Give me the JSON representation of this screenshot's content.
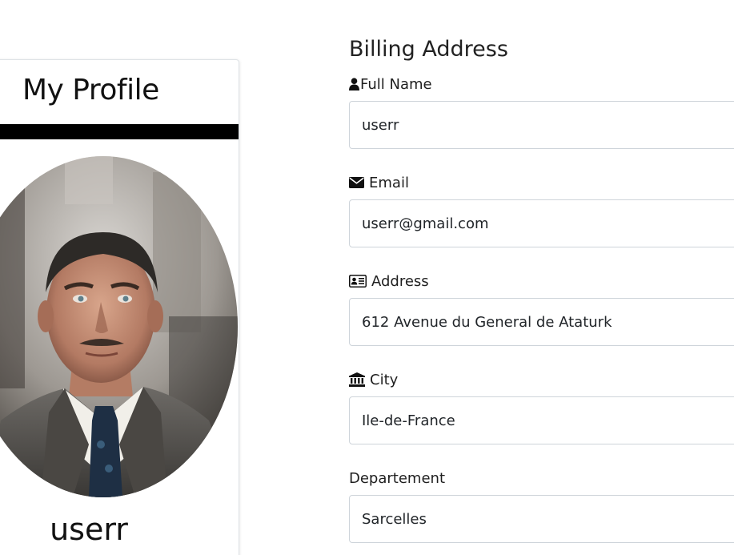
{
  "profile": {
    "title": "My Profile",
    "name": "userr"
  },
  "billing": {
    "title": "Billing Address",
    "fields": {
      "full_name": {
        "label": "Full Name",
        "value": "userr",
        "icon": "user-icon"
      },
      "email": {
        "label": "Email",
        "value": "userr@gmail.com",
        "icon": "envelope-icon"
      },
      "address": {
        "label": "Address",
        "value": "612 Avenue du General de Ataturk",
        "icon": "address-card-icon"
      },
      "city": {
        "label": "City",
        "value": "Ile-de-France",
        "icon": "institution-icon"
      },
      "departement": {
        "label": "Departement",
        "value": "Sarcelles"
      }
    }
  },
  "colors": {
    "bar": "#000000",
    "border": "#ced4da"
  }
}
